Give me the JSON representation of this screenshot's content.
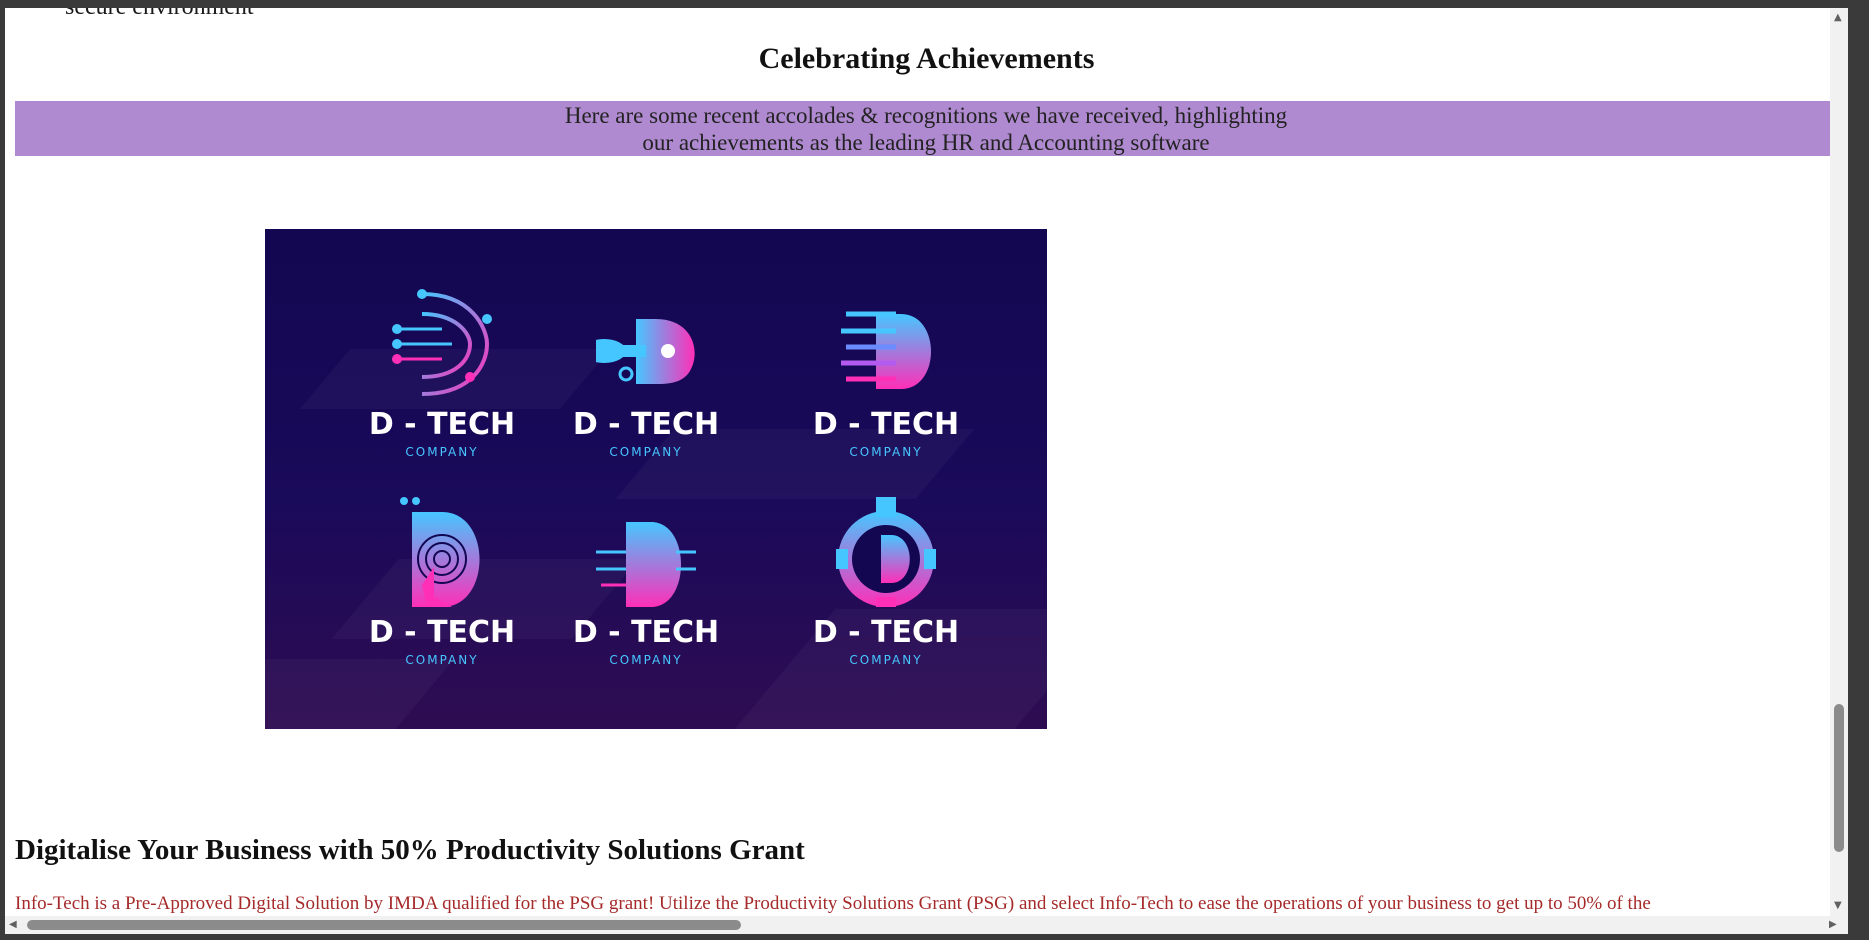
{
  "page": {
    "cut_text": "secure environment",
    "section_title": "Celebrating Achievements",
    "banner_line1": "Here are some recent accolades & recognitions we have received, highlighting",
    "banner_line2": "our achievements as the leading HR and Accounting software",
    "promo_heading": "Digitalise Your Business with 50% Productivity Solutions Grant",
    "promo_text": "Info-Tech is a Pre-Approved Digital Solution by IMDA qualified for the PSG grant! Utilize the Productivity Solutions Grant (PSG) and select Info-Tech to ease the operations of your business to get up to 50% of the"
  },
  "logos": [
    {
      "name": "D - TECH",
      "sub": "COMPANY",
      "icon": "circuit-d-icon"
    },
    {
      "name": "D - TECH",
      "sub": "COMPANY",
      "icon": "plug-d-icon"
    },
    {
      "name": "D - TECH",
      "sub": "COMPANY",
      "icon": "lines-d-icon"
    },
    {
      "name": "D - TECH",
      "sub": "COMPANY",
      "icon": "fingerprint-d-icon"
    },
    {
      "name": "D - TECH",
      "sub": "COMPANY",
      "icon": "chip-d-icon"
    },
    {
      "name": "D - TECH",
      "sub": "COMPANY",
      "icon": "gear-d-icon"
    }
  ],
  "colors": {
    "banner_bg": "#b08ad0",
    "panel_bg": "#130751",
    "accent_cyan": "#46c6ff",
    "accent_pink": "#ff2fb8",
    "promo_text": "#a52a2a"
  }
}
